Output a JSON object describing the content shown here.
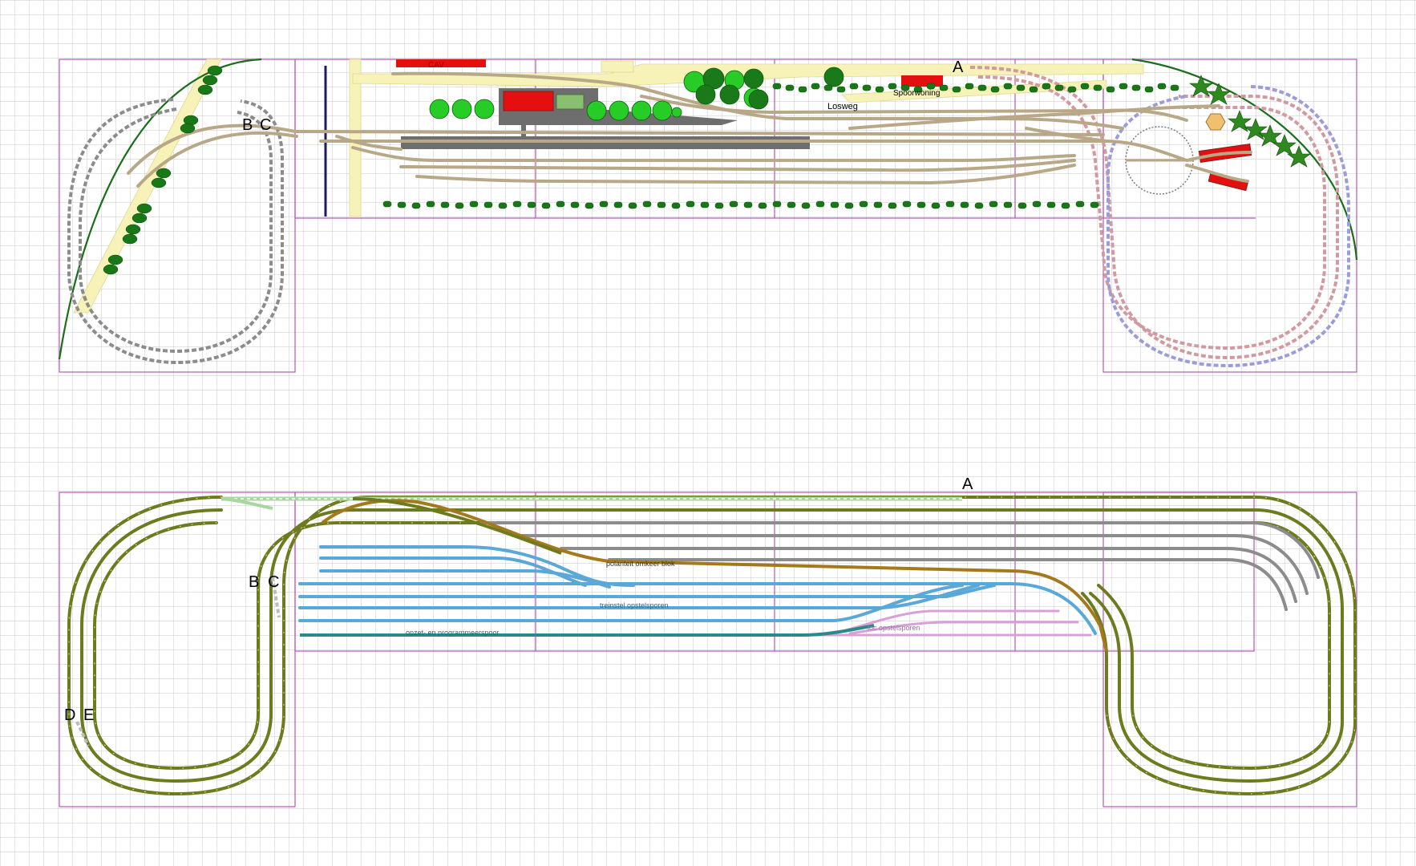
{
  "upper_plan": {
    "labels": {
      "marker_a": "A",
      "marker_b": "B",
      "marker_c": "C",
      "road": "Losweg",
      "house": "Spoorwoning",
      "factory_sign": "CAV"
    }
  },
  "lower_plan": {
    "labels": {
      "marker_a": "A",
      "marker_b": "B",
      "marker_c": "C",
      "marker_d": "D",
      "marker_e": "E",
      "reverse_block": "polariteit omkeer blok",
      "train_sidings": "treinstel opstelsporen",
      "extra_sidings": "loc opstelsporen",
      "programming_track": "opzet- en programmeerspoor"
    }
  },
  "colors": {
    "grid": "#c8c8c8",
    "frame": "#b45ab4",
    "track_upper": "#b8a888",
    "hidden_gray": "#8c8c8c",
    "hidden_red": "#d09aa0",
    "hidden_blue": "#9c9cd8",
    "road_yellow": "#f6f2b8",
    "platform": "#6e6e6e",
    "red_building": "#e41010",
    "tree_light": "#27cc27",
    "tree_dark": "#1a7a1a",
    "hedge": "#187818",
    "main_loop": "#6e7a1e",
    "main_loop_ties": "#e8e8b0",
    "brown_track": "#a4791c",
    "blue_siding": "#5aa8d8",
    "gray_siding": "#8c8c8c",
    "pink_siding": "#d8a0d8",
    "teal_track": "#2a8a8a",
    "pale_green": "#a8d8a0",
    "dark_line": "#1c1c5a"
  }
}
